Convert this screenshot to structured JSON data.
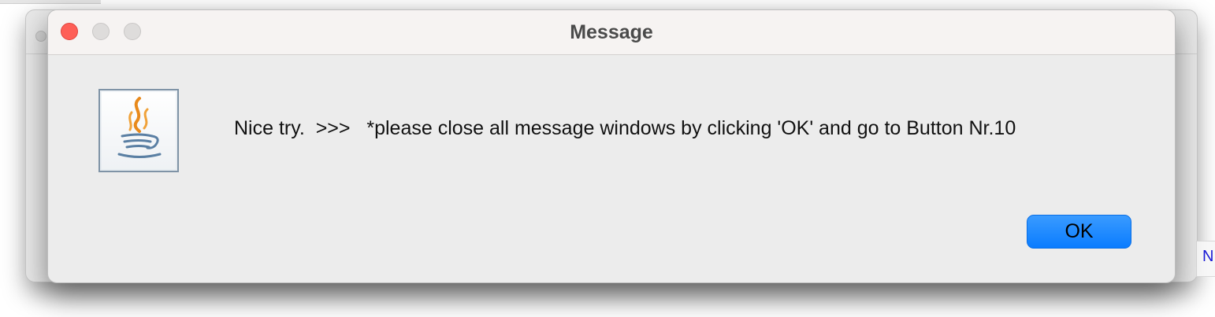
{
  "dialog": {
    "title": "Message",
    "message": "Nice try.  >>>   *please close all message windows by clicking 'OK' and go to Button Nr.10",
    "ok_label": "OK",
    "icon": "java-icon"
  },
  "background": {
    "right_remnant_text": "N"
  },
  "colors": {
    "close_light": "#fe5f57",
    "ok_button": "#0a7cff",
    "java_orange": "#e8891b",
    "java_blue": "#5a7fa3"
  }
}
